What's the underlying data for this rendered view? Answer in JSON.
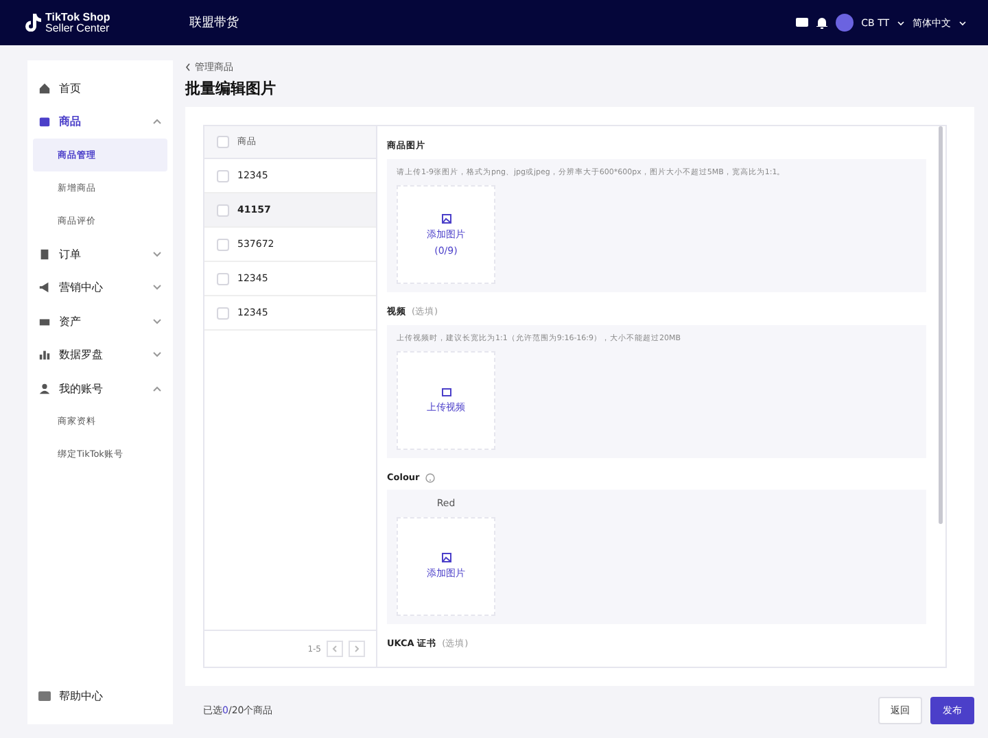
{
  "header": {
    "logo_line1": "TikTok Shop",
    "logo_line2": "Seller Center",
    "nav": "联盟带货",
    "user": "CB TT",
    "language": "简体中文"
  },
  "sidebar": {
    "items": [
      {
        "label": "首页",
        "selected": false
      },
      {
        "label": "商品",
        "expanded": true,
        "selected": true,
        "children": [
          {
            "label": "商品管理",
            "selected": true
          },
          {
            "label": "新增商品",
            "selected": false
          },
          {
            "label": "商品评价",
            "selected": false
          }
        ]
      },
      {
        "label": "订单",
        "expanded": false,
        "selected": false
      },
      {
        "label": "营销中心",
        "expanded": false,
        "selected": false
      },
      {
        "label": "资产",
        "expanded": false,
        "selected": false
      },
      {
        "label": "数据罗盘",
        "expanded": false,
        "selected": false
      },
      {
        "label": "我的账号",
        "expanded": true,
        "selected": false,
        "children": [
          {
            "label": "商家资料",
            "selected": false
          },
          {
            "label": "绑定TikTok账号",
            "selected": false
          }
        ]
      }
    ],
    "help": "帮助中心"
  },
  "breadcrumb": "管理商品",
  "page_title": "批量编辑图片",
  "table": {
    "column": "商品",
    "header_checked": false,
    "rows": [
      {
        "name": "12345",
        "checked": false,
        "selected": false
      },
      {
        "name": "41157",
        "checked": false,
        "selected": true
      },
      {
        "name": "537672",
        "checked": false,
        "selected": false
      },
      {
        "name": "12345",
        "checked": false,
        "selected": false
      },
      {
        "name": "12345",
        "checked": false,
        "selected": false
      }
    ],
    "pagination": "1-5"
  },
  "sections": [
    {
      "kind": "image_upload",
      "title": "商品图片",
      "hint": "请上传1-9张图片，格式为png、jpg或jpeg，分辨率大于600*600px，图片大小不超过5MB，宽高比为1:1。",
      "tile_label": "添加图片",
      "tile_count": "(0/9)"
    },
    {
      "kind": "video_upload",
      "title": "视频",
      "optional": "(选填)",
      "hint": "上传视频时，建议长宽比为1:1（允许范围为9:16-16:9），大小不能超过20MB",
      "tile_label": "上传视频"
    },
    {
      "kind": "variant",
      "title": "Colour",
      "help": true,
      "variant": "Red",
      "tile_label": "添加图片"
    },
    {
      "kind": "heading",
      "title": "UKCA 证书",
      "optional": "(选填)"
    }
  ],
  "footer": {
    "selected_prefix": "已选",
    "selected_count": "0",
    "selected_suffix": "/20个商品",
    "buttons": [
      {
        "label": "返回",
        "kind": "secondary"
      },
      {
        "label": "发布",
        "kind": "primary"
      }
    ]
  }
}
